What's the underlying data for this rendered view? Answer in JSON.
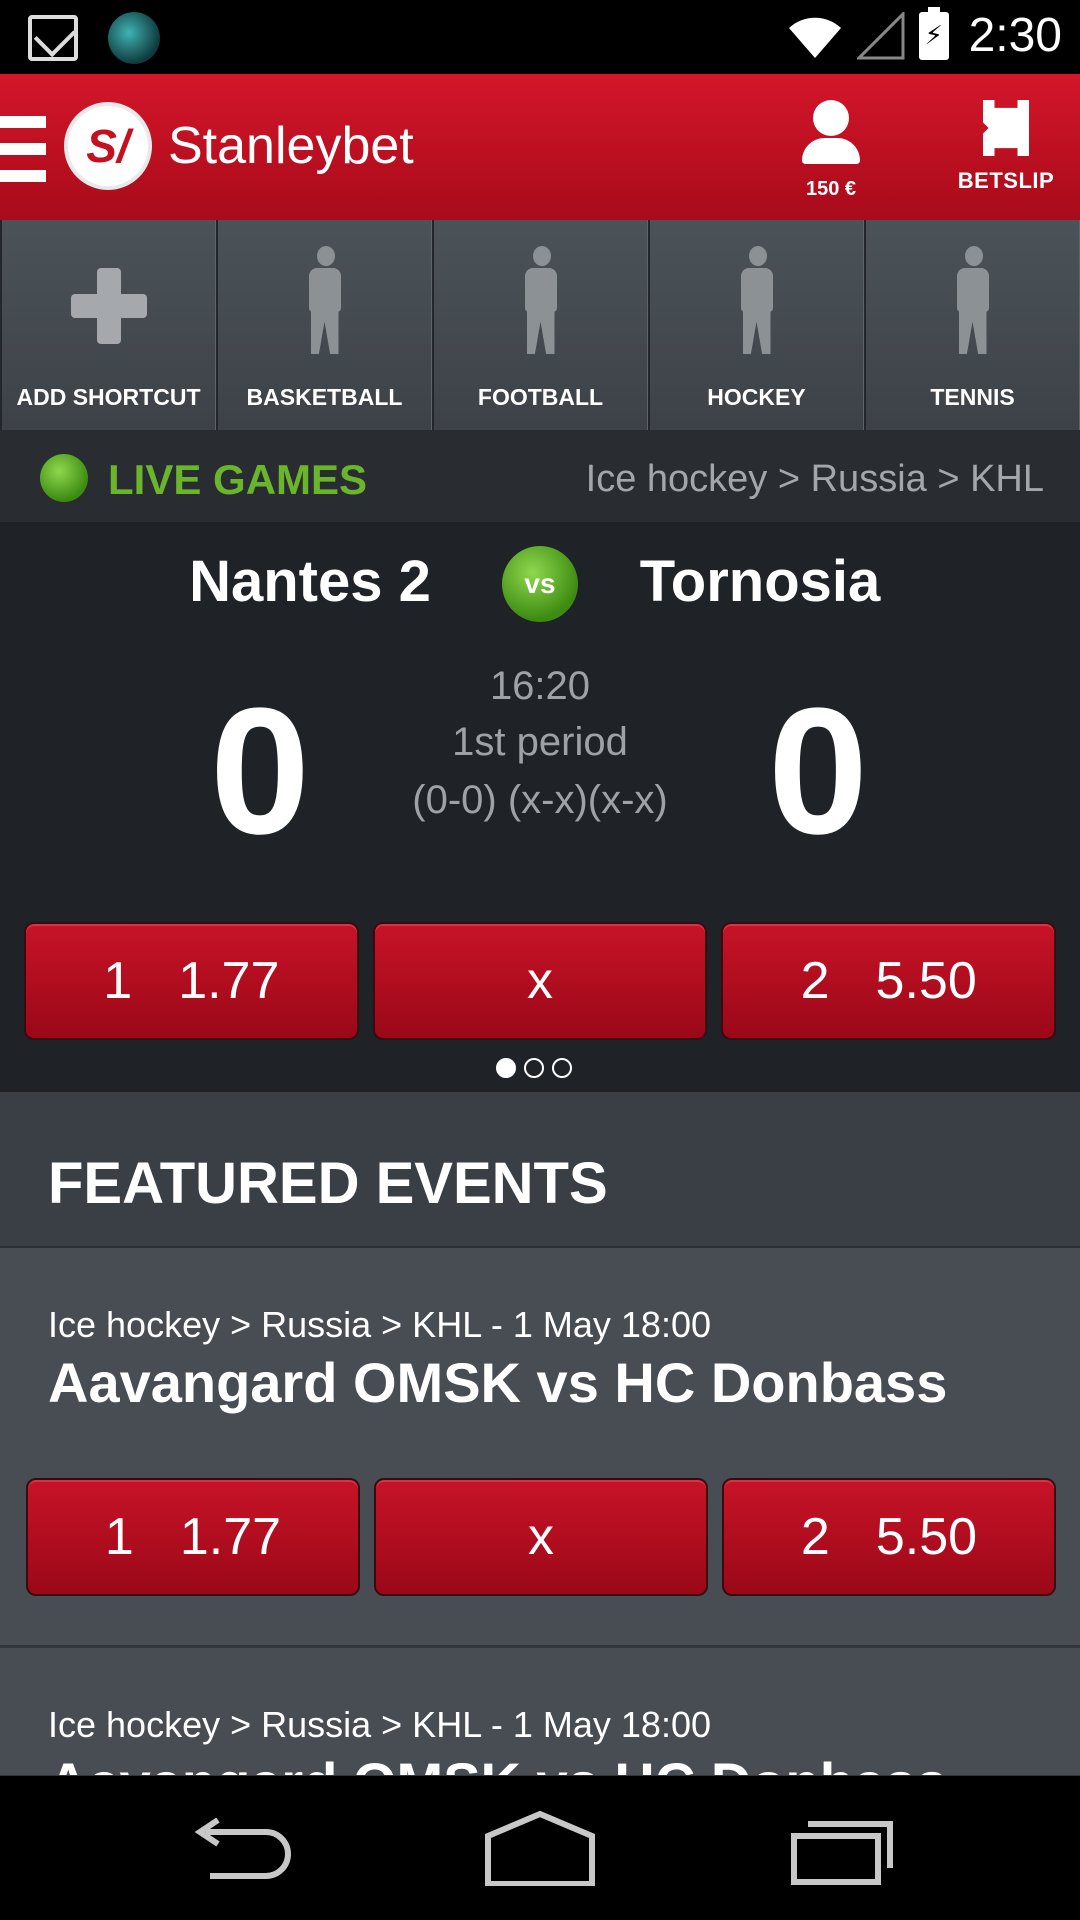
{
  "status_bar": {
    "time": "2:30",
    "icons": [
      "gmail-icon",
      "globe-app-icon",
      "wifi-icon",
      "signal-icon",
      "battery-charging-icon"
    ]
  },
  "header": {
    "logo_text": "S/",
    "title": "Stanleybet",
    "account_label": "150 €",
    "betslip_label": "BETSLIP",
    "brand_color": "#c8102e"
  },
  "shortcuts": [
    {
      "label": "ADD SHORTCUT",
      "icon": "plus-icon"
    },
    {
      "label": "BASKETBALL",
      "icon": "basketball-player-icon"
    },
    {
      "label": "FOOTBALL",
      "icon": "football-player-icon"
    },
    {
      "label": "HOCKEY",
      "icon": "hockey-player-icon"
    },
    {
      "label": "TENNIS",
      "icon": "tennis-player-icon"
    }
  ],
  "live": {
    "title": "LIVE GAMES",
    "breadcrumb": "Ice hockey > Russia > KHL",
    "accent_color": "#6ab52b"
  },
  "live_match": {
    "home": "Nantes 2",
    "away": "Tornosia",
    "vs": "vs",
    "home_score": "0",
    "away_score": "0",
    "time": "16:20",
    "period": "1st period",
    "sets": "(0-0) (x-x)(x-x)",
    "odds": [
      {
        "key": "1",
        "value": "1.77"
      },
      {
        "key": "x",
        "value": ""
      },
      {
        "key": "2",
        "value": "5.50"
      }
    ],
    "pager": {
      "pages": 3,
      "active": 1
    }
  },
  "featured": {
    "title": "FEATURED EVENTS",
    "events": [
      {
        "meta": "Ice hockey > Russia > KHL - 1 May 18:00",
        "title": "Aavangard OMSK vs HC Donbass",
        "odds": [
          {
            "key": "1",
            "value": "1.77"
          },
          {
            "key": "x",
            "value": ""
          },
          {
            "key": "2",
            "value": "5.50"
          }
        ]
      },
      {
        "meta": "Ice hockey > Russia > KHL - 1 May 18:00",
        "title": "Aavangard OMSK vs HC Donbass"
      }
    ]
  },
  "nav": {
    "icons": [
      "back-icon",
      "home-icon",
      "recent-apps-icon"
    ]
  }
}
